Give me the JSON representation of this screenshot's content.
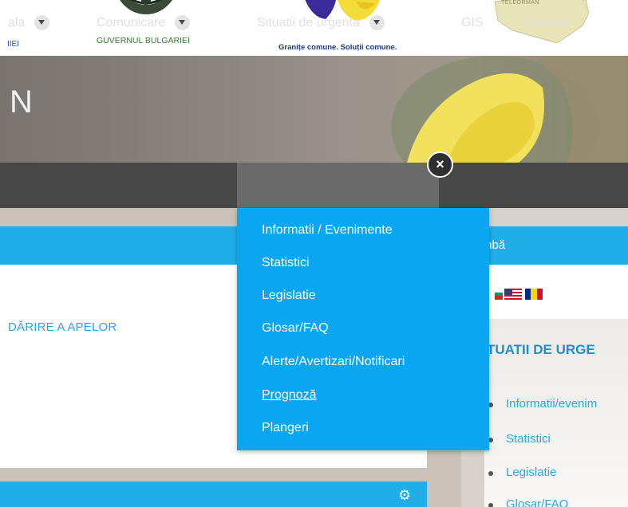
{
  "logos": {
    "left_partial": "IIEI",
    "bulgaria": "GUVERNUL BULGARIEI",
    "motto": "Granițe comune. Soluții comune.",
    "map_label": "TELEORMAN"
  },
  "hero": {
    "title_partial": "N"
  },
  "nav": {
    "items": [
      {
        "label": "ala",
        "has_dropdown": true
      },
      {
        "label": "Comunicare",
        "has_dropdown": true
      },
      {
        "label": "Situatii de urgenta",
        "has_dropdown": true,
        "active": true
      },
      {
        "label": "GIS",
        "has_dropdown": false
      },
      {
        "label": "Contact",
        "has_dropdown": false
      }
    ],
    "close_symbol": "×"
  },
  "dropdown": {
    "items": [
      {
        "label": "Informatii / Evenimente"
      },
      {
        "label": "Statistici"
      },
      {
        "label": "Legislatie"
      },
      {
        "label": "Glosar/FAQ"
      },
      {
        "label": "Alerte/Avertizari/Notificari"
      },
      {
        "label": "Prognoză",
        "underlined": true
      },
      {
        "label": "Plangeri"
      }
    ]
  },
  "main": {
    "heading_partial": "DĂRIRE A APELOR",
    "gear_symbol": "⚙"
  },
  "sidebar": {
    "language_label": "mbă",
    "urgent_title": "TUATII DE URGE",
    "list": [
      {
        "label": "Informatii/evenim"
      },
      {
        "label": "Statistici"
      },
      {
        "label": "Legislatie"
      },
      {
        "label": "Glosar/FAQ"
      }
    ]
  },
  "colors": {
    "accent_blue": "#1faee8",
    "dropdown_blue": "#0aa6f2",
    "navbar": "#484747"
  }
}
